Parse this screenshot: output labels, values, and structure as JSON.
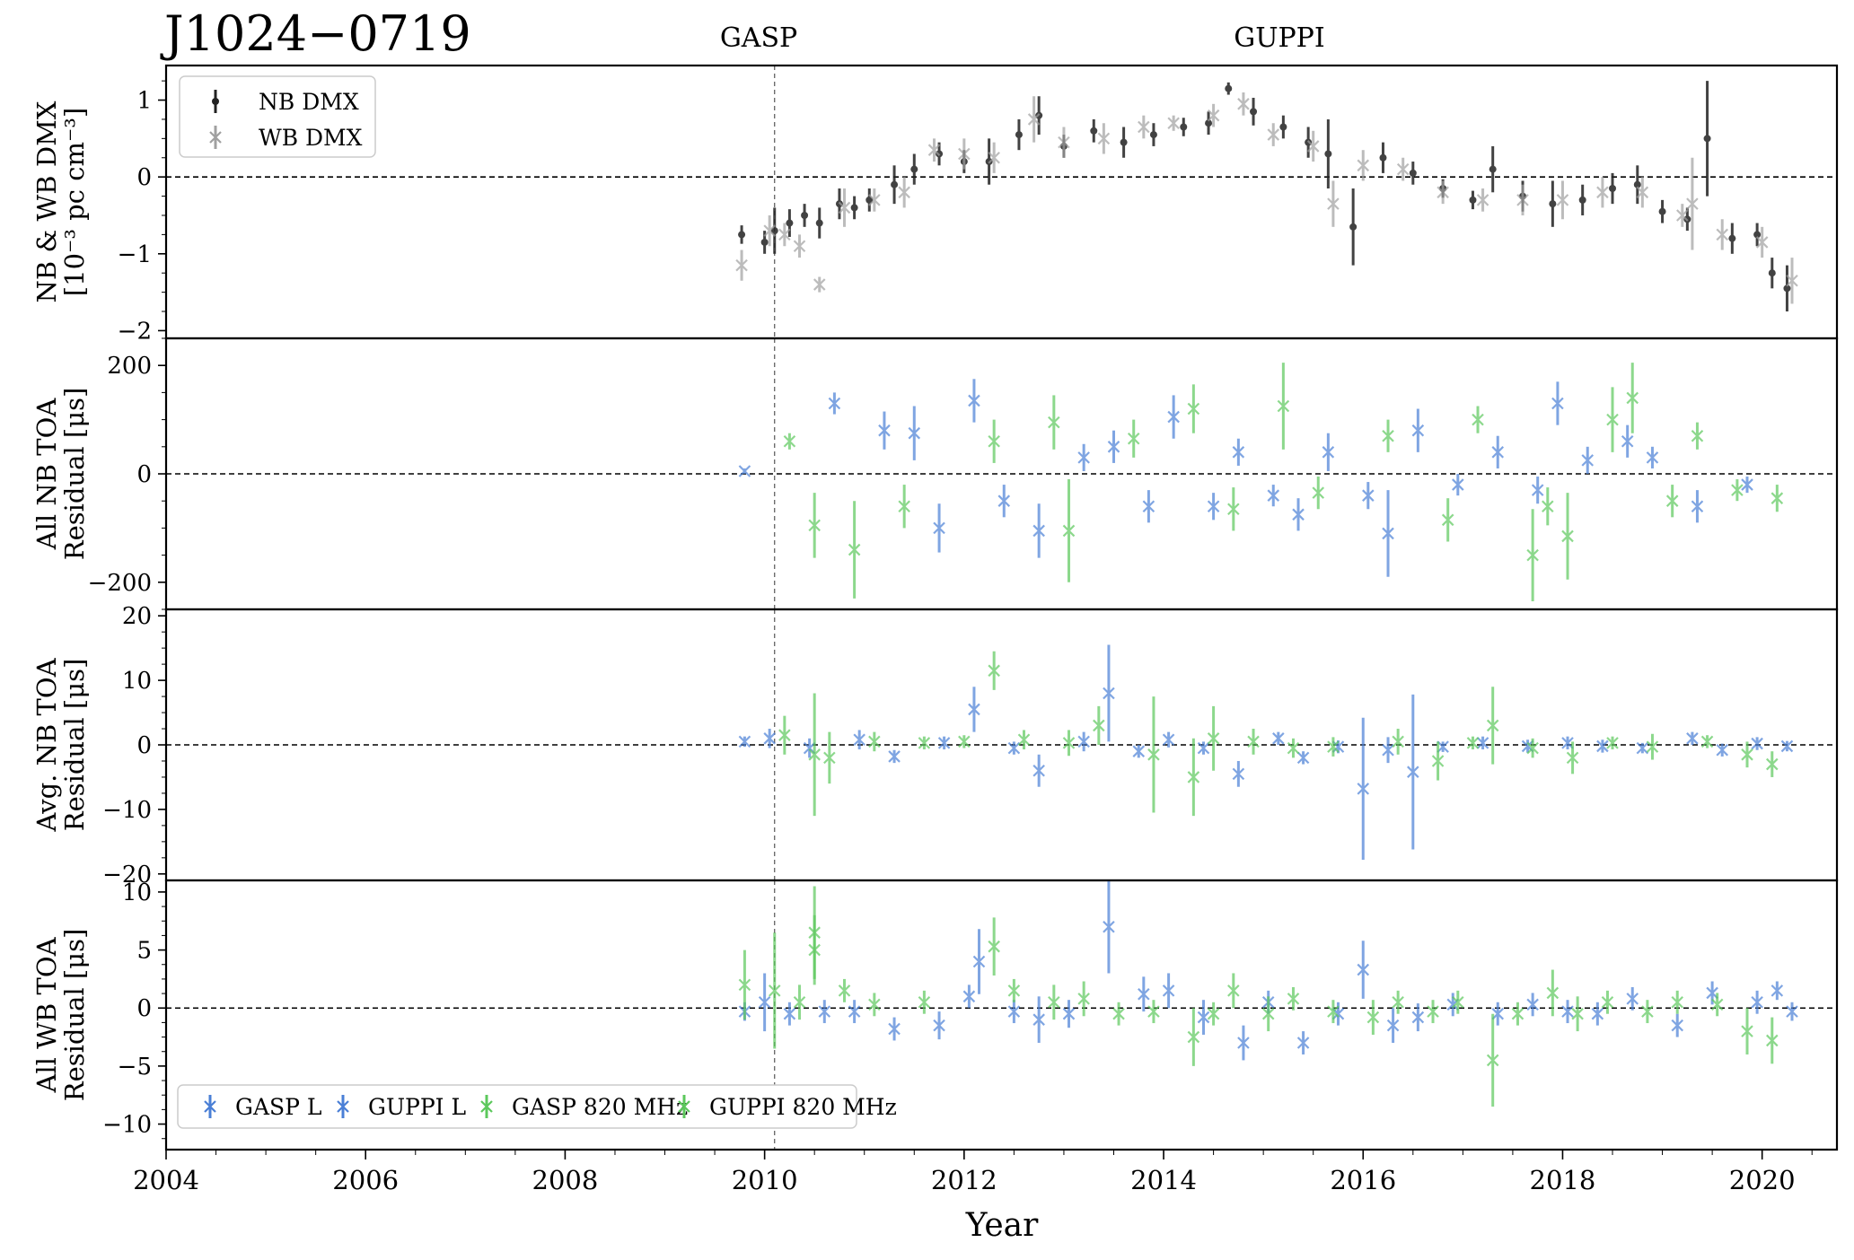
{
  "figure": {
    "pulsar": "J1024−0719",
    "backend_labels": [
      "GASP",
      "GUPPI"
    ],
    "xlabel": "Year",
    "x_ticks": [
      2004,
      2006,
      2008,
      2010,
      2012,
      2014,
      2016,
      2018,
      2020
    ],
    "xlim": [
      2004.0,
      2020.75
    ],
    "backend_switch_year": 2010.1
  },
  "colors": {
    "nb_dmx": "#222222",
    "wb_dmx": "#a0a0a0",
    "gasp_l": "#4a7fd6",
    "guppi_l": "#4a7fd6",
    "gasp_820": "#5cc85c",
    "guppi_820": "#5cc85c"
  },
  "chart_data": [
    {
      "type": "scatter",
      "panel": "dmx",
      "ylabel_lines": [
        "NB & WB DMX",
        "[10⁻³ pc cm⁻³]"
      ],
      "ylim": [
        -2.1,
        1.45
      ],
      "y_ticks": [
        -2,
        -1,
        0,
        1
      ],
      "zero_line": true,
      "legend": {
        "placement": "upper-left",
        "entries": [
          "NB DMX",
          "WB DMX"
        ]
      },
      "series": [
        {
          "name": "NB DMX",
          "x": [
            2009.77,
            2010.0,
            2010.1,
            2010.25,
            2010.4,
            2010.55,
            2010.75,
            2010.9,
            2011.05,
            2011.3,
            2011.5,
            2011.75,
            2012.0,
            2012.25,
            2012.55,
            2012.75,
            2013.0,
            2013.3,
            2013.6,
            2013.9,
            2014.2,
            2014.45,
            2014.65,
            2014.9,
            2015.2,
            2015.45,
            2015.65,
            2015.9,
            2016.2,
            2016.5,
            2016.8,
            2017.1,
            2017.3,
            2017.6,
            2017.9,
            2018.2,
            2018.5,
            2018.75,
            2019.0,
            2019.25,
            2019.45,
            2019.7,
            2019.95,
            2020.1,
            2020.25
          ],
          "y": [
            -0.75,
            -0.85,
            -0.7,
            -0.6,
            -0.5,
            -0.6,
            -0.35,
            -0.4,
            -0.3,
            -0.1,
            0.1,
            0.3,
            0.2,
            0.2,
            0.55,
            0.8,
            0.4,
            0.6,
            0.45,
            0.55,
            0.65,
            0.7,
            1.15,
            0.85,
            0.65,
            0.45,
            0.3,
            -0.65,
            0.25,
            0.05,
            -0.15,
            -0.3,
            0.1,
            -0.25,
            -0.35,
            -0.3,
            -0.15,
            -0.1,
            -0.45,
            -0.55,
            0.5,
            -0.8,
            -0.75,
            -1.25,
            -1.45
          ],
          "err": [
            0.12,
            0.15,
            0.3,
            0.18,
            0.15,
            0.2,
            0.2,
            0.15,
            0.15,
            0.25,
            0.2,
            0.15,
            0.15,
            0.3,
            0.2,
            0.25,
            0.15,
            0.15,
            0.2,
            0.15,
            0.12,
            0.15,
            0.08,
            0.18,
            0.15,
            0.2,
            0.45,
            0.5,
            0.2,
            0.15,
            0.12,
            0.12,
            0.3,
            0.2,
            0.3,
            0.2,
            0.2,
            0.25,
            0.15,
            0.15,
            0.75,
            0.2,
            0.15,
            0.2,
            0.3
          ]
        },
        {
          "name": "WB DMX",
          "x": [
            2009.77,
            2010.05,
            2010.2,
            2010.35,
            2010.55,
            2010.8,
            2011.1,
            2011.4,
            2011.7,
            2012.0,
            2012.3,
            2012.7,
            2013.0,
            2013.4,
            2013.8,
            2014.1,
            2014.5,
            2014.8,
            2015.1,
            2015.5,
            2015.7,
            2016.0,
            2016.4,
            2016.8,
            2017.2,
            2017.6,
            2018.0,
            2018.4,
            2018.8,
            2019.2,
            2019.3,
            2019.6,
            2020.0,
            2020.3
          ],
          "y": [
            -1.15,
            -0.7,
            -0.75,
            -0.9,
            -1.4,
            -0.4,
            -0.3,
            -0.2,
            0.35,
            0.3,
            0.25,
            0.75,
            0.45,
            0.5,
            0.65,
            0.7,
            0.8,
            0.95,
            0.55,
            0.4,
            -0.35,
            0.15,
            0.1,
            -0.2,
            -0.3,
            -0.3,
            -0.3,
            -0.2,
            -0.2,
            -0.5,
            -0.35,
            -0.75,
            -0.85,
            -1.35
          ],
          "err": [
            0.2,
            0.2,
            0.15,
            0.15,
            0.1,
            0.25,
            0.15,
            0.2,
            0.15,
            0.2,
            0.2,
            0.3,
            0.2,
            0.2,
            0.15,
            0.1,
            0.15,
            0.15,
            0.15,
            0.2,
            0.3,
            0.2,
            0.15,
            0.15,
            0.15,
            0.2,
            0.25,
            0.2,
            0.2,
            0.15,
            0.6,
            0.2,
            0.2,
            0.3
          ]
        }
      ]
    },
    {
      "type": "scatter",
      "panel": "nb_toa",
      "ylabel_lines": [
        "All NB TOA",
        "Residual [μs]"
      ],
      "ylim": [
        -250,
        250
      ],
      "y_ticks": [
        -200,
        0,
        200
      ],
      "zero_line": true,
      "series": [
        {
          "name": "GUPPI L",
          "x": [
            2009.8,
            2010.7,
            2011.2,
            2011.5,
            2011.75,
            2012.1,
            2012.4,
            2012.75,
            2013.2,
            2013.5,
            2013.85,
            2014.1,
            2014.5,
            2014.75,
            2015.1,
            2015.35,
            2015.65,
            2016.05,
            2016.25,
            2016.55,
            2016.95,
            2017.35,
            2017.75,
            2017.95,
            2018.25,
            2018.65,
            2018.9,
            2019.35,
            2019.85
          ],
          "y": [
            5,
            130,
            80,
            75,
            -100,
            135,
            -50,
            -105,
            30,
            50,
            -60,
            105,
            -60,
            40,
            -40,
            -75,
            40,
            -40,
            -110,
            80,
            -20,
            40,
            -30,
            130,
            25,
            60,
            30,
            -60,
            -20
          ],
          "err": [
            5,
            20,
            35,
            50,
            45,
            40,
            30,
            50,
            25,
            30,
            30,
            40,
            25,
            25,
            20,
            30,
            35,
            25,
            80,
            40,
            20,
            30,
            25,
            40,
            25,
            30,
            20,
            30,
            15
          ]
        },
        {
          "name": "GUPPI 820 MHz",
          "x": [
            2010.25,
            2010.5,
            2010.9,
            2011.4,
            2012.3,
            2012.9,
            2013.05,
            2013.7,
            2014.3,
            2014.7,
            2015.2,
            2015.55,
            2016.25,
            2016.85,
            2017.15,
            2017.7,
            2017.85,
            2018.05,
            2018.5,
            2018.7,
            2019.1,
            2019.35,
            2019.75,
            2020.15
          ],
          "y": [
            60,
            -95,
            -140,
            -60,
            60,
            95,
            -105,
            65,
            120,
            -65,
            125,
            -35,
            70,
            -85,
            100,
            -150,
            -60,
            -115,
            100,
            140,
            -50,
            70,
            -30,
            -45
          ],
          "err": [
            15,
            60,
            90,
            40,
            40,
            50,
            95,
            35,
            45,
            40,
            80,
            30,
            30,
            40,
            25,
            85,
            35,
            80,
            60,
            65,
            30,
            25,
            20,
            25
          ]
        }
      ]
    },
    {
      "type": "scatter",
      "panel": "avg_nb_toa",
      "ylabel_lines": [
        "Avg. NB TOA",
        "Residual [μs]"
      ],
      "ylim": [
        -21,
        21
      ],
      "y_ticks": [
        -20,
        -10,
        0,
        10,
        20
      ],
      "zero_line": true,
      "series": [
        {
          "name": "GUPPI L",
          "x": [
            2009.8,
            2010.05,
            2010.45,
            2010.95,
            2011.3,
            2011.8,
            2012.1,
            2012.5,
            2012.75,
            2013.2,
            2013.45,
            2013.75,
            2014.05,
            2014.4,
            2014.75,
            2015.15,
            2015.4,
            2015.75,
            2016.0,
            2016.25,
            2016.5,
            2016.8,
            2017.2,
            2017.65,
            2018.05,
            2018.4,
            2018.8,
            2019.3,
            2019.6,
            2019.95,
            2020.25
          ],
          "y": [
            0.5,
            1.0,
            -0.5,
            0.8,
            -1.8,
            0.3,
            5.5,
            -0.5,
            -4.0,
            0.5,
            8.0,
            -1.0,
            0.8,
            -0.5,
            -4.5,
            1.0,
            -2.0,
            -0.3,
            -6.8,
            -0.8,
            -4.2,
            -0.3,
            0.3,
            -0.2,
            0.3,
            -0.2,
            -0.5,
            1.0,
            -0.8,
            0.2,
            -0.2
          ],
          "err": [
            0.8,
            1.5,
            1.5,
            1.5,
            1.0,
            1.0,
            3.5,
            1.0,
            2.5,
            1.5,
            7.5,
            1.0,
            1.2,
            1.0,
            2.0,
            1.0,
            1.0,
            1.0,
            11.0,
            2.0,
            12.0,
            0.8,
            1.0,
            1.0,
            1.0,
            1.0,
            0.8,
            1.0,
            1.0,
            1.0,
            0.8
          ]
        },
        {
          "name": "GUPPI 820 MHz",
          "x": [
            2010.2,
            2010.5,
            2010.65,
            2011.1,
            2011.6,
            2012.0,
            2012.3,
            2012.6,
            2013.05,
            2013.35,
            2013.9,
            2014.3,
            2014.5,
            2014.9,
            2015.3,
            2015.7,
            2016.35,
            2016.75,
            2017.1,
            2017.3,
            2017.7,
            2018.1,
            2018.5,
            2018.9,
            2019.45,
            2019.85,
            2020.1
          ],
          "y": [
            1.5,
            -1.5,
            -2.0,
            0.5,
            0.3,
            0.5,
            11.5,
            0.8,
            0.3,
            3.0,
            -1.5,
            -5.0,
            1.0,
            0.5,
            -0.5,
            -0.3,
            0.5,
            -2.5,
            0.3,
            3.0,
            -0.5,
            -2.0,
            0.3,
            -0.3,
            0.5,
            -1.5,
            -3.0
          ],
          "err": [
            3.0,
            9.5,
            4.0,
            1.5,
            1.0,
            1.0,
            3.0,
            1.5,
            2.0,
            3.0,
            9.0,
            6.0,
            5.0,
            2.0,
            1.5,
            1.5,
            2.0,
            3.0,
            1.0,
            6.0,
            1.5,
            2.5,
            1.0,
            2.0,
            1.0,
            2.0,
            2.0
          ]
        }
      ]
    },
    {
      "type": "scatter",
      "panel": "wb_toa",
      "ylabel_lines": [
        "All WB TOA",
        "Residual [μs]"
      ],
      "ylim": [
        -12.2,
        11
      ],
      "y_ticks": [
        -10,
        -5,
        0,
        5,
        10
      ],
      "zero_line": true,
      "legend": {
        "placement": "lower-left",
        "entries": [
          "GASP L",
          "GUPPI L",
          "GASP 820 MHz",
          "GUPPI 820 MHz"
        ]
      },
      "series": [
        {
          "name": "GASP L",
          "x": [
            2009.8,
            2010.0,
            2010.25,
            2010.6
          ],
          "y": [
            -0.3,
            0.5,
            -0.5,
            -0.3
          ],
          "err": [
            0.8,
            2.5,
            1.0,
            1.0
          ]
        },
        {
          "name": "GUPPI L",
          "x": [
            2010.9,
            2011.3,
            2011.75,
            2012.05,
            2012.15,
            2012.5,
            2012.75,
            2013.05,
            2013.45,
            2013.8,
            2014.05,
            2014.4,
            2014.8,
            2015.05,
            2015.4,
            2015.75,
            2016.0,
            2016.3,
            2016.55,
            2016.9,
            2017.35,
            2017.7,
            2018.05,
            2018.35,
            2018.7,
            2019.15,
            2019.5,
            2019.95,
            2020.15,
            2020.3
          ],
          "y": [
            -0.3,
            -1.8,
            -1.5,
            1.0,
            4.0,
            -0.3,
            -1.0,
            -0.5,
            7.0,
            1.2,
            1.5,
            -0.8,
            -3.0,
            0.5,
            -3.0,
            -0.5,
            3.3,
            -1.5,
            -0.8,
            0.3,
            -0.5,
            0.3,
            -0.3,
            -0.5,
            0.8,
            -1.5,
            1.3,
            0.5,
            1.5,
            -0.3
          ],
          "err": [
            1.0,
            1.0,
            1.2,
            1.0,
            2.8,
            1.0,
            2.0,
            1.2,
            4.0,
            1.5,
            1.5,
            1.5,
            1.5,
            1.0,
            1.0,
            1.0,
            2.5,
            1.5,
            1.2,
            1.0,
            1.0,
            1.0,
            1.0,
            1.0,
            1.0,
            1.0,
            1.0,
            1.0,
            0.8,
            0.8
          ]
        },
        {
          "name": "GASP 820 MHz",
          "x": [
            2009.8,
            2010.1,
            2010.35,
            2010.5
          ],
          "y": [
            2.0,
            1.5,
            0.5,
            6.5
          ],
          "err": [
            3.0,
            5.0,
            1.5,
            4.0
          ]
        },
        {
          "name": "GUPPI 820 MHz",
          "x": [
            2010.5,
            2010.8,
            2011.1,
            2011.6,
            2012.3,
            2012.5,
            2012.9,
            2013.2,
            2013.55,
            2013.9,
            2014.3,
            2014.5,
            2014.7,
            2015.05,
            2015.3,
            2015.7,
            2016.1,
            2016.35,
            2016.7,
            2016.95,
            2017.3,
            2017.55,
            2017.9,
            2018.15,
            2018.45,
            2018.85,
            2019.15,
            2019.55,
            2019.85,
            2020.1
          ],
          "y": [
            5.0,
            1.5,
            0.3,
            0.5,
            5.3,
            1.5,
            0.5,
            0.8,
            -0.5,
            -0.3,
            -2.5,
            -0.5,
            1.5,
            -0.5,
            0.8,
            -0.3,
            -0.8,
            0.5,
            -0.3,
            0.5,
            -4.5,
            -0.5,
            1.3,
            -0.5,
            0.5,
            -0.3,
            0.5,
            0.3,
            -2.0,
            -2.8
          ],
          "err": [
            3.0,
            1.0,
            1.0,
            1.0,
            2.5,
            1.0,
            1.5,
            1.5,
            1.0,
            1.0,
            2.5,
            1.0,
            1.5,
            1.5,
            1.0,
            1.0,
            1.5,
            1.0,
            1.0,
            1.0,
            4.0,
            1.0,
            2.0,
            1.5,
            1.0,
            1.0,
            1.0,
            1.0,
            2.0,
            2.0
          ]
        }
      ]
    }
  ]
}
